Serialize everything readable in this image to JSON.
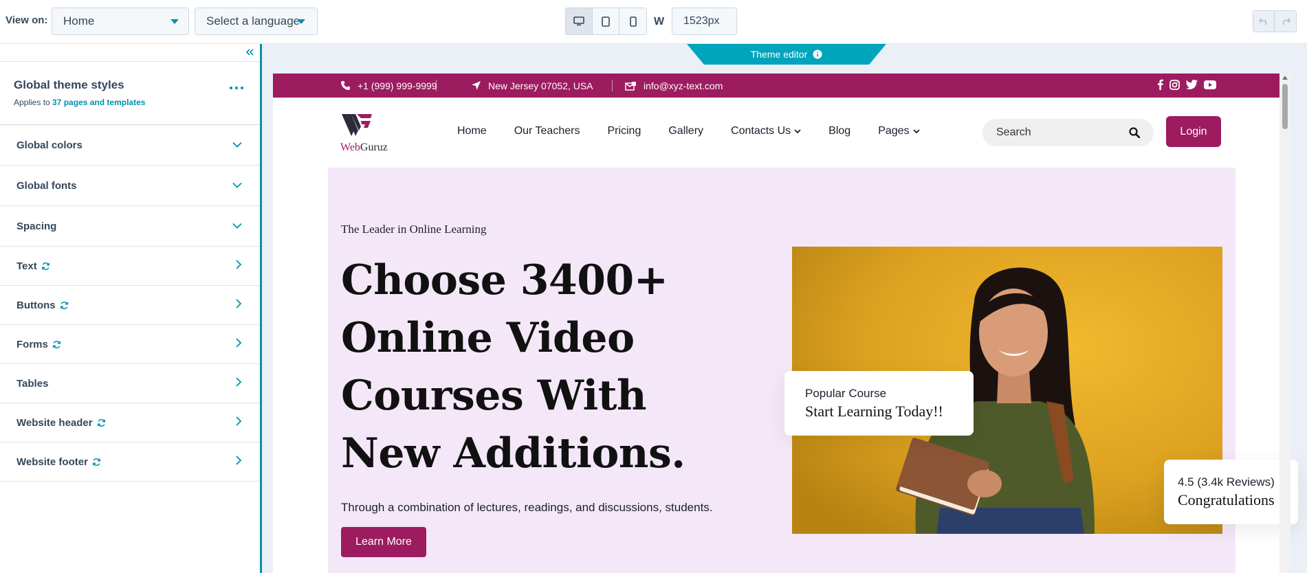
{
  "toolbar": {
    "view_on_label": "View on:",
    "page_select": "Home",
    "language_select": "Select a language",
    "width_label": "W",
    "width_value": "1523px"
  },
  "panel": {
    "title": "Global theme styles",
    "subtitle_prefix": "Applies to ",
    "subtitle_link": "37 pages and templates",
    "sections": [
      {
        "label": "Global colors",
        "chevron": "down",
        "sync": false
      },
      {
        "label": "Global fonts",
        "chevron": "down",
        "sync": false
      },
      {
        "label": "Spacing",
        "chevron": "down",
        "sync": false
      },
      {
        "label": "Text",
        "chevron": "right",
        "sync": true
      },
      {
        "label": "Buttons",
        "chevron": "right",
        "sync": true
      },
      {
        "label": "Forms",
        "chevron": "right",
        "sync": true
      },
      {
        "label": "Tables",
        "chevron": "right",
        "sync": false
      },
      {
        "label": "Website header",
        "chevron": "right",
        "sync": true
      },
      {
        "label": "Website footer",
        "chevron": "right",
        "sync": true
      }
    ]
  },
  "theme_editor": {
    "label": "Theme editor"
  },
  "site": {
    "topbar": {
      "phone": "+1 (999) 999-9999",
      "location": "New Jersey 07052, USA",
      "email": "info@xyz-text.com"
    },
    "logo_text_part1": "Web",
    "logo_text_part2": "Guruz",
    "nav": [
      "Home",
      "Our Teachers",
      "Pricing",
      "Gallery",
      "Contacts Us",
      "Blog",
      "Pages"
    ],
    "search_placeholder": "Search",
    "login": "Login",
    "hero": {
      "eyebrow": "The Leader in Online Learning",
      "headline": "Choose 3400+ Online Video Courses With New Additions.",
      "lead": "Through a combination of lectures, readings, and discussions, students.",
      "cta": "Learn More",
      "card1_small": "Popular Course",
      "card1_big": "Start Learning Today!!",
      "card2_small": "4.5 (3.4k Reviews)",
      "card2_big": "Congratulations"
    }
  },
  "colors": {
    "brand": "#9c1c5f",
    "accent": "#0091ae",
    "hero_bg": "#f4e8f8"
  }
}
